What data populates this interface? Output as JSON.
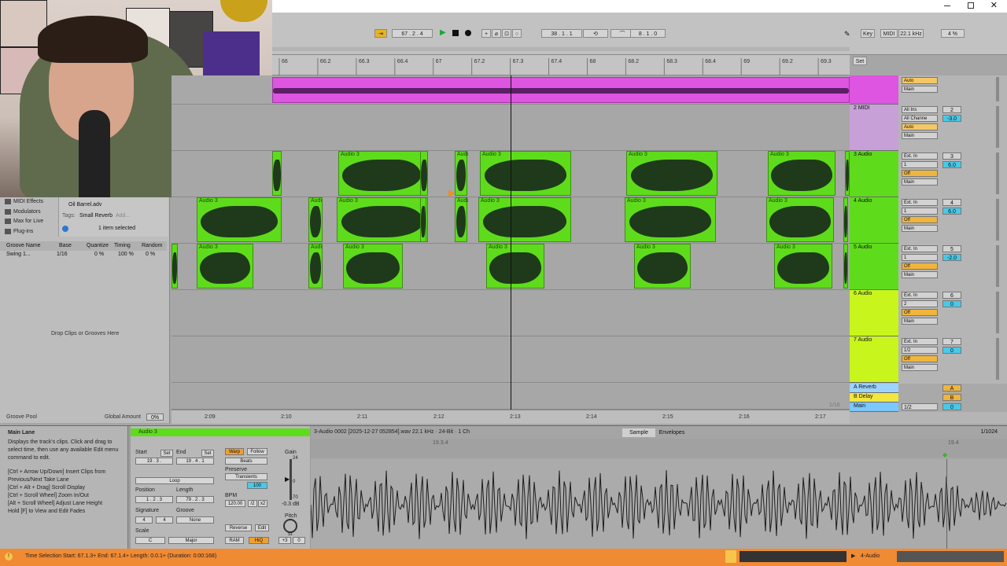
{
  "transport": {
    "position": "67 . 2 . 4",
    "loop_start": "38 . 1 . 1",
    "loop_length": "8 . 1 . 0"
  },
  "toolbar_right": {
    "key": "Key",
    "midi": "MIDI",
    "sample_rate": "22.1 kHz",
    "cpu": "4 %"
  },
  "ruler": {
    "bars": [
      "66",
      "66.2",
      "66.3",
      "66.4",
      "67",
      "67.2",
      "67.3",
      "67.4",
      "68",
      "68.2",
      "68.3",
      "68.4",
      "69",
      "69.2",
      "69.3"
    ],
    "set_label": "Set"
  },
  "browser": {
    "items": [
      "MIDI Effects",
      "Modulators",
      "Max for Live",
      "Plug-ins"
    ],
    "preset_name": "Oil Barrel.adv",
    "tags_label": "Tags:",
    "tags_value": "Small Reverb",
    "tags_add": "Add...",
    "selection_info": "1 item selected",
    "groove_headers": [
      "Groove Name",
      "Base",
      "Quantize",
      "Timing",
      "Random"
    ],
    "groove_row": {
      "name": "Swing 1...",
      "base": "1/16",
      "quantize": "0 %",
      "timing": "100 %",
      "random": "0 %"
    },
    "drop_hint": "Drop Clips or Grooves Here",
    "groove_pool": "Groove Pool",
    "global_amount_label": "Global Amount",
    "global_amount_value": "0%"
  },
  "clip_label": "Audio 3",
  "clip_label_short": "Audi",
  "tracks": [
    {
      "name": "",
      "color": "#dd55e0",
      "input": "",
      "channel": "",
      "monitor": "Auto",
      "output": "Main",
      "number": "",
      "vol": ""
    },
    {
      "name": "2 MIDI",
      "color": "#c7a0d8",
      "input": "All Ins",
      "channel": "All Channe",
      "monitor": "Auto",
      "output": "Main",
      "number": "2",
      "vol": "-3.0"
    },
    {
      "name": "3 Audio",
      "color": "#5edc1c",
      "input": "Ext. In",
      "channel": "1",
      "monitor": "Off",
      "output": "Main",
      "number": "3",
      "vol": "6.0"
    },
    {
      "name": "4 Audio",
      "color": "#5edc1c",
      "input": "Ext. In",
      "channel": "1",
      "monitor": "Off",
      "output": "Main",
      "number": "4",
      "vol": "6.0"
    },
    {
      "name": "5 Audio",
      "color": "#5edc1c",
      "input": "Ext. In",
      "channel": "1",
      "monitor": "Off",
      "output": "Main",
      "number": "5",
      "vol": "-2.0"
    },
    {
      "name": "6 Audio",
      "color": "#c8f51c",
      "input": "Ext. In",
      "channel": "2",
      "monitor": "Off",
      "output": "Main",
      "number": "6",
      "vol": "0"
    },
    {
      "name": "7 Audio",
      "color": "#c8f51c",
      "input": "Ext. In",
      "channel": "1/2",
      "monitor": "Off",
      "output": "Main",
      "number": "7",
      "vol": "0"
    }
  ],
  "returns": [
    {
      "name": "A Reverb",
      "letter": "A"
    },
    {
      "name": "B Delay",
      "letter": "B"
    },
    {
      "name": "Main",
      "letter": "0",
      "routing": "1/2"
    }
  ],
  "timeline": {
    "labels": [
      "2:09",
      "2:10",
      "2:11",
      "2:12",
      "2:13",
      "2:14",
      "2:15",
      "2:16",
      "2:17"
    ],
    "zoom": "1/16"
  },
  "info_view": {
    "title": "Main Lane",
    "body": "Displays the track's clips. Click and drag to select time, then use any available Edit menu command to edit.",
    "shortcuts": [
      "[Ctrl + Arrow Up/Down] Insert Clips from Previous/Next Take Lane",
      "[Ctrl + Alt + Drag] Scroll Display",
      "[Ctrl + Scroll Wheel] Zoom In/Out",
      "[Alt + Scroll Wheel] Adjust Lane Height",
      "Hold [F] to View and Edit Fades"
    ]
  },
  "clip_view": {
    "name": "Audio 3",
    "start_label": "Start",
    "end_label": "End",
    "set": "Set",
    "start": "19 . 3 .",
    "end": "19 . 4 . 1",
    "loop": "Loop",
    "position_label": "Position",
    "length_label": "Length",
    "position": "1 . 2 . 3",
    "length": "79 . 2 . 3",
    "signature_label": "Signature",
    "sig_num": "4",
    "sig_den": "4",
    "groove_label": "Groove",
    "groove_value": "None",
    "scale_label": "Scale",
    "scale_root": "C",
    "scale_name": "Major",
    "warp": "Warp",
    "follow": "Follow",
    "mode": "Beats",
    "preserve_label": "Preserve",
    "preserve": "Transients",
    "grain": "100",
    "bpm_label": "BPM",
    "bpm": "120.00",
    "half": "/2",
    "double": "x2",
    "reverse": "Reverse",
    "edit": "Edit",
    "ram": "RAM",
    "hiq": "HiQ",
    "gain_label": "Gain",
    "gain_value": "-0.3 dB",
    "gain_top": "24",
    "gain_zero": "0",
    "gain_bottom": "-70",
    "pitch_label": "Pitch",
    "pitch_st": "st",
    "pitch_value": "+3",
    "pitch_cents": "0"
  },
  "sample_view": {
    "file": "3-Audio 0002 [2025-12-27 052854].wav  22.1 kHz · 24-Bit · 1 Ch",
    "tabs": [
      "Sample",
      "Envelopes"
    ],
    "zoom": "1/1024",
    "marker_left": "19.3.4",
    "marker_right": "19.4"
  },
  "status": {
    "text": "Time Selection   Start: 67.1.3+   End: 67.1.4+   Length: 0.0.1+   (Duration: 0:00:168)",
    "track": "4-Audio"
  }
}
